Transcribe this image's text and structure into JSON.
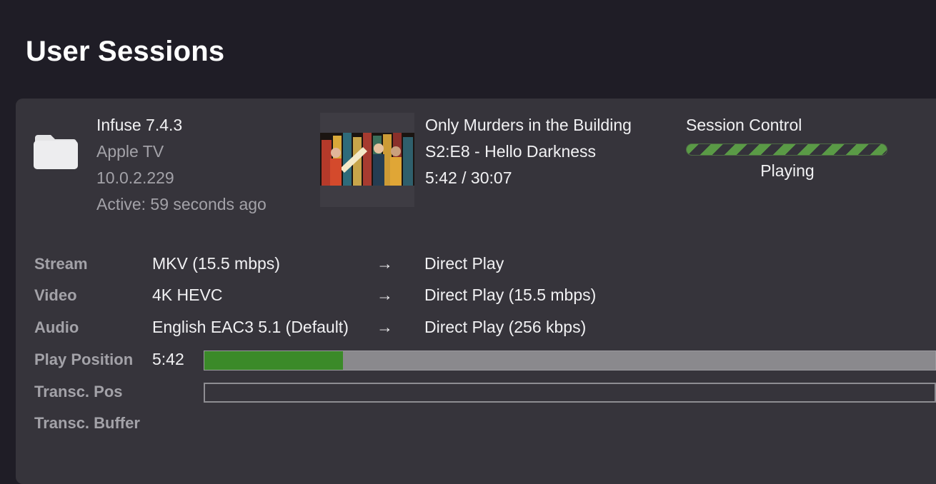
{
  "page": {
    "title": "User Sessions"
  },
  "session": {
    "client": {
      "name": "Infuse 7.4.3",
      "device": "Apple TV",
      "ip": "10.0.2.229",
      "active": "Active: 59 seconds ago",
      "icon": "folder-icon"
    },
    "media": {
      "show": "Only Murders in the Building",
      "episode": "S2:E8 - Hello Darkness",
      "time": "5:42 / 30:07"
    },
    "control": {
      "title": "Session Control",
      "status": "Playing"
    },
    "details": {
      "stream": {
        "label": "Stream",
        "source": "MKV (15.5 mbps)",
        "arrow": "→",
        "target": "Direct Play"
      },
      "video": {
        "label": "Video",
        "source": "4K HEVC",
        "arrow": "→",
        "target": "Direct Play (15.5 mbps)"
      },
      "audio": {
        "label": "Audio",
        "source": "English EAC3 5.1 (Default)",
        "arrow": "→",
        "target": "Direct Play (256 kbps)"
      },
      "play_position": {
        "label": "Play Position",
        "value": "5:42",
        "progress_fraction": 0.19
      },
      "transc_pos": {
        "label": "Transc. Pos",
        "progress_fraction": 0
      },
      "transc_buffer": {
        "label": "Transc. Buffer"
      }
    }
  },
  "colors": {
    "background": "#1f1d26",
    "card": "#36343b",
    "progress_fill": "#3b8a29",
    "progress_track": "#8a898d",
    "status_stripe": "#5a9a46"
  }
}
